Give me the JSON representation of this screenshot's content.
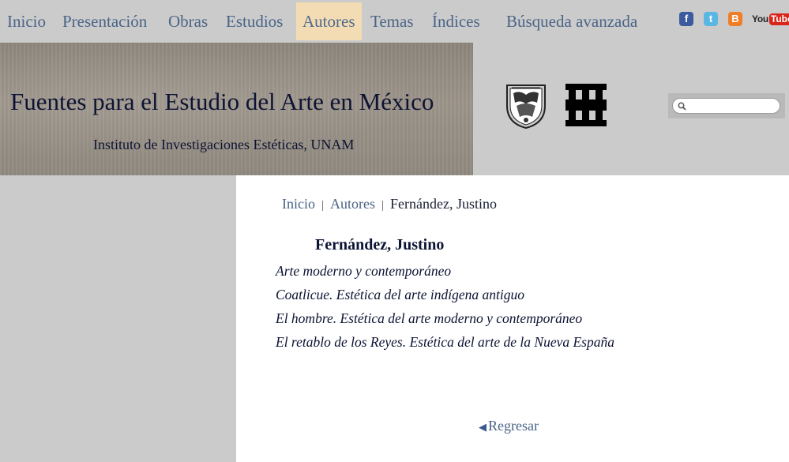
{
  "nav": {
    "items": [
      {
        "label": "Inicio"
      },
      {
        "label": "Presentación"
      },
      {
        "label": "Obras"
      },
      {
        "label": "Estudios"
      },
      {
        "label": "Autores",
        "active": true
      },
      {
        "label": "Temas"
      },
      {
        "label": "Índices"
      },
      {
        "label": "Búsqueda avanzada"
      }
    ],
    "social": [
      {
        "name": "facebook-icon",
        "glyph": "f"
      },
      {
        "name": "twitter-icon",
        "glyph": "t"
      },
      {
        "name": "blogger-icon",
        "glyph": "B"
      },
      {
        "name": "youtube-icon",
        "you": "You",
        "tube": "Tube"
      }
    ]
  },
  "header": {
    "title": "Fuentes para el Estudio del Arte en México",
    "subtitle": "Instituto de Investigaciones Estéticas, UNAM",
    "search_placeholder": ""
  },
  "breadcrumb": {
    "items": [
      "Inicio",
      "Autores"
    ],
    "separator": "|",
    "current": "Fernández, Justino"
  },
  "author": {
    "name": "Fernández, Justino",
    "works": [
      "Arte moderno y contemporáneo",
      "Coatlicue. Estética del arte indígena antiguo",
      "El hombre. Estética del arte moderno y contemporáneo",
      "El retablo de los Reyes. Estética del arte de la Nueva España"
    ]
  },
  "back": {
    "arrow": "◀",
    "label": "Regresar"
  },
  "colors": {
    "link": "#4a6486",
    "active_bg": "#f3dcb3",
    "text": "#0d1333",
    "page_bg": "#cbcbcb"
  }
}
